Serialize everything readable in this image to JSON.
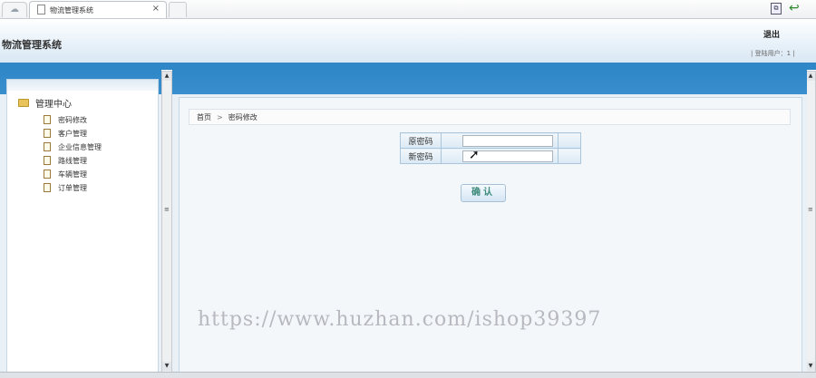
{
  "browser": {
    "tab_title": "物流管理系统",
    "tab_close": "×",
    "home_icon": "cloud-icon",
    "toolbar_icons": [
      "page-tools-icon",
      "back-arrow-icon"
    ]
  },
  "header": {
    "app_title": "物流管理系统",
    "logout_label": "退出",
    "login_user_text": "| 登陆用户：1 |"
  },
  "sidebar": {
    "root_label": "管理中心",
    "items": [
      {
        "label": "密码修改"
      },
      {
        "label": "客户管理"
      },
      {
        "label": "企业信息管理"
      },
      {
        "label": "路线管理"
      },
      {
        "label": "车辆管理"
      },
      {
        "label": "订单管理"
      }
    ]
  },
  "breadcrumb": {
    "home": "首页",
    "separator": ">",
    "current": "密码修改"
  },
  "form": {
    "old_password_label": "原密码",
    "new_password_label": "新密码",
    "old_password_value": "",
    "new_password_value": "",
    "confirm_label": "确认"
  },
  "scrollbar": {
    "grip": "≡",
    "up": "▲",
    "down": "▼"
  },
  "watermark": "https://www.huzhan.com/ishop39397",
  "colors": {
    "accent_blue": "#2f87c8",
    "panel_bg": "#e9f0f6"
  }
}
